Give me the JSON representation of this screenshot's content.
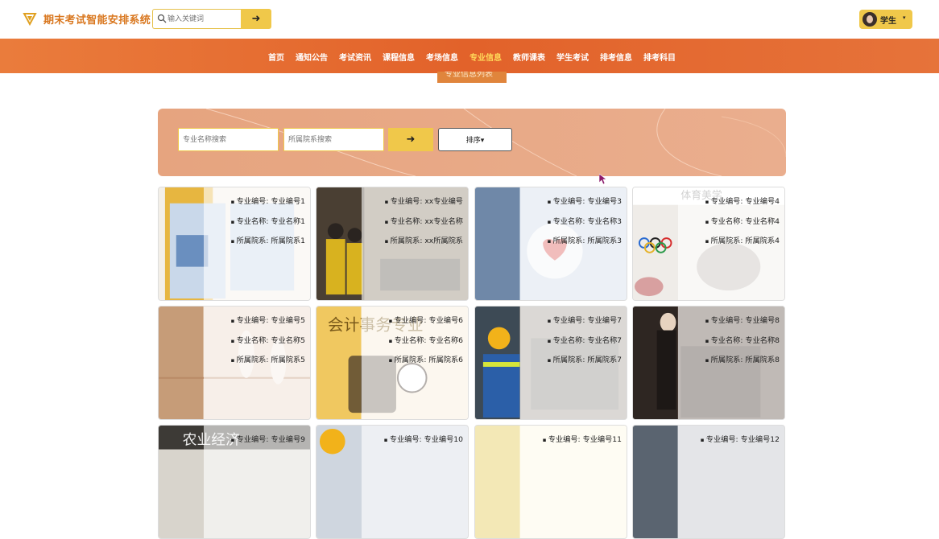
{
  "app": {
    "title": "期末考试智能安排系统",
    "search_placeholder": "输入关键词",
    "search_button": "➜",
    "user_label": "学生",
    "user_caret": "▾"
  },
  "nav": {
    "items": [
      "首页",
      "通知公告",
      "考试资讯",
      "课程信息",
      "考场信息",
      "专业信息",
      "教师课表",
      "学生考试",
      "排考信息",
      "排考科目"
    ],
    "active_index": 5
  },
  "page": {
    "subtitle": "专业信息列表"
  },
  "filter": {
    "name_placeholder": "专业名称搜索",
    "dept_placeholder": "所属院系搜索",
    "go_button": "➜",
    "sort_button": "排序▾"
  },
  "labels": {
    "code": "专业编号:",
    "name": "专业名称:",
    "dept": "所属院系:"
  },
  "cards": [
    {
      "code": "专业编号1",
      "name": "专业名称1",
      "dept": "所属院系1",
      "theme": "book"
    },
    {
      "code": "xx专业编号",
      "name": "xx专业名称",
      "dept": "xx所属院系",
      "theme": "students"
    },
    {
      "code": "专业编号3",
      "name": "专业名称3",
      "dept": "所属院系3",
      "theme": "medical"
    },
    {
      "code": "专业编号4",
      "name": "专业名称4",
      "dept": "所属院系4",
      "theme": "sports"
    },
    {
      "code": "专业编号5",
      "name": "专业名称5",
      "dept": "所属院系5",
      "theme": "dance"
    },
    {
      "code": "专业编号6",
      "name": "专业名称6",
      "dept": "所属院系6",
      "theme": "accounting"
    },
    {
      "code": "专业编号7",
      "name": "专业名称7",
      "dept": "所属院系7",
      "theme": "engineering"
    },
    {
      "code": "专业编号8",
      "name": "专业名称8",
      "dept": "所属院系8",
      "theme": "music"
    },
    {
      "code": "专业编号9",
      "name": "",
      "dept": "",
      "theme": "agriculture"
    },
    {
      "code": "专业编号10",
      "name": "",
      "dept": "",
      "theme": "construction"
    },
    {
      "code": "专业编号11",
      "name": "",
      "dept": "",
      "theme": "cream"
    },
    {
      "code": "专业编号12",
      "name": "",
      "dept": "",
      "theme": "gray"
    }
  ],
  "colors": {
    "accent": "#f0c84a",
    "nav": "#e2622a",
    "title": "#d9771f",
    "active_nav": "#ffd95a",
    "filter_panel": "#e6a47f"
  }
}
